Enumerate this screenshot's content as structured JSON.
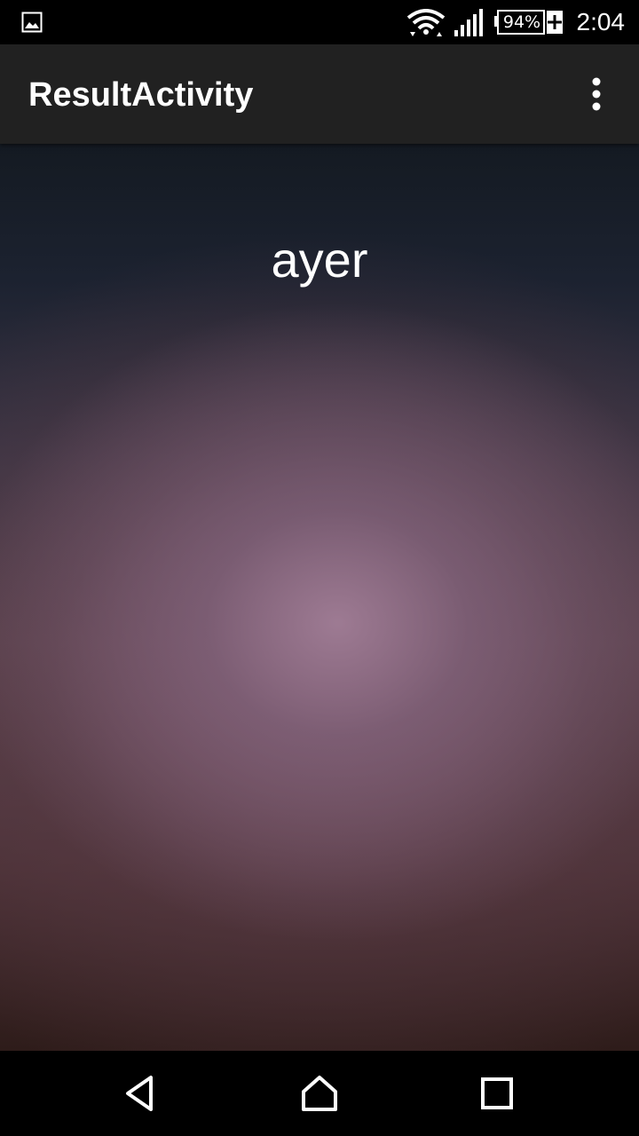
{
  "status_bar": {
    "battery_percent": "94%",
    "time": "2:04",
    "icons": [
      "image-notification-icon",
      "wifi-icon",
      "cell-signal-icon",
      "battery-charging-icon"
    ]
  },
  "app_bar": {
    "title": "ResultActivity",
    "overflow_icon": "more-vert-icon"
  },
  "content": {
    "result_text": "ayer"
  },
  "nav_bar": {
    "icons": [
      "back-icon",
      "home-icon",
      "recents-icon"
    ]
  }
}
